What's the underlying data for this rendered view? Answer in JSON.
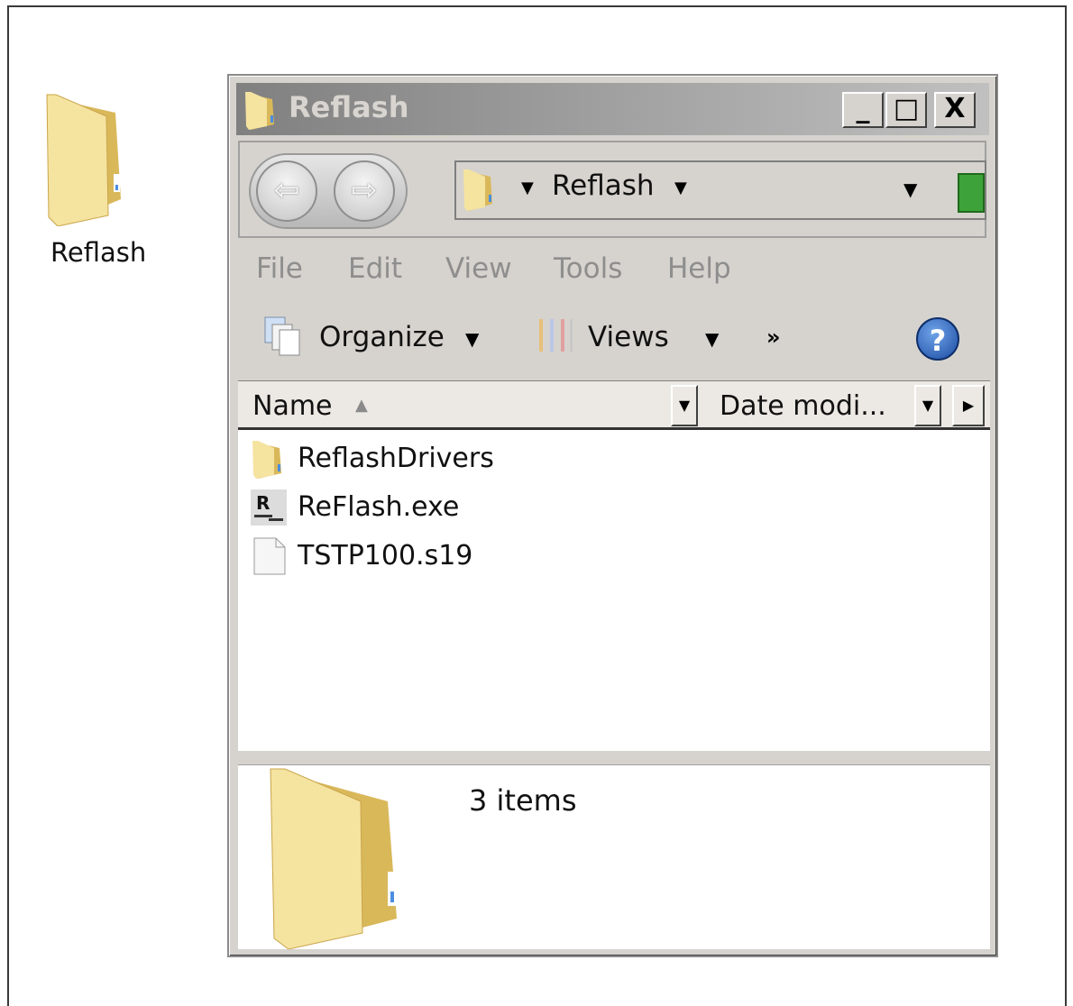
{
  "desktop": {
    "icon_label": "Reflash"
  },
  "window": {
    "title": "Reflash",
    "buttons": {
      "minimize": "_",
      "maximize": "□",
      "close": "X"
    },
    "address": {
      "current_folder": "Reflash"
    },
    "menu": [
      "File",
      "Edit",
      "View",
      "Tools",
      "Help"
    ],
    "toolbar": {
      "organize": "Organize",
      "views": "Views",
      "more": "»",
      "help": "?"
    },
    "columns": {
      "name": "Name",
      "date": "Date modi..."
    },
    "files": [
      {
        "name": "ReflashDrivers",
        "icon": "folder-icon"
      },
      {
        "name": "ReFlash.exe",
        "icon": "exe-icon"
      },
      {
        "name": "TSTP100.s19",
        "icon": "file-icon"
      }
    ],
    "details": {
      "count": "3 items"
    }
  },
  "colors": {
    "folder": "#f2dc8c",
    "folder_dark": "#d9b85a",
    "title_gradient_start": "#808080",
    "window_bg": "#d6d3ce"
  }
}
